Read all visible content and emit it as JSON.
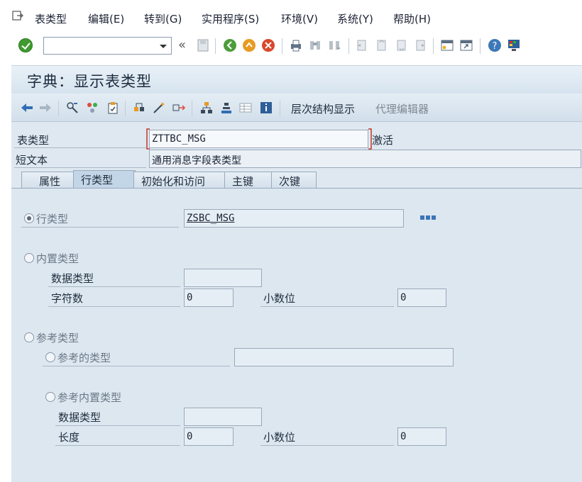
{
  "menu": {
    "items": [
      "表类型",
      "编辑(E)",
      "转到(G)",
      "实用程序(S)",
      "环境(V)",
      "系统(Y)",
      "帮助(H)"
    ]
  },
  "toolbar": {
    "command_value": "",
    "back_symbol": "«"
  },
  "header": {
    "title": "字典：显示表类型"
  },
  "app_toolbar": {
    "hierarchy_label": "层次结构显示",
    "proxy_label": "代理编辑器"
  },
  "form": {
    "table_type_label": "表类型",
    "table_type_value": "ZTTBC_MSG",
    "status": "激活",
    "short_text_label": "短文本",
    "short_text_value": "通用消息字段表类型"
  },
  "tabs": [
    "属性",
    "行类型",
    "初始化和访问",
    "主键",
    "次键"
  ],
  "panel": {
    "row_type_label": "行类型",
    "row_type_value": "ZSBC_MSG",
    "builtin_label": "内置类型",
    "data_type_label": "数据类型",
    "chars_label": "字符数",
    "chars_value": "0",
    "decimals_label": "小数位",
    "decimals_value": "0",
    "ref_type_label": "参考类型",
    "ref_of_type_label": "参考的类型",
    "ref_builtin_label": "参考内置类型",
    "ref_data_type_label": "数据类型",
    "length_label": "长度",
    "length_value": "0",
    "ref_decimals_label": "小数位",
    "ref_decimals_value": "0"
  },
  "colors": {
    "ok": "#3f9a2f",
    "cancel": "#d9482b",
    "panel": "#dde7f0"
  }
}
